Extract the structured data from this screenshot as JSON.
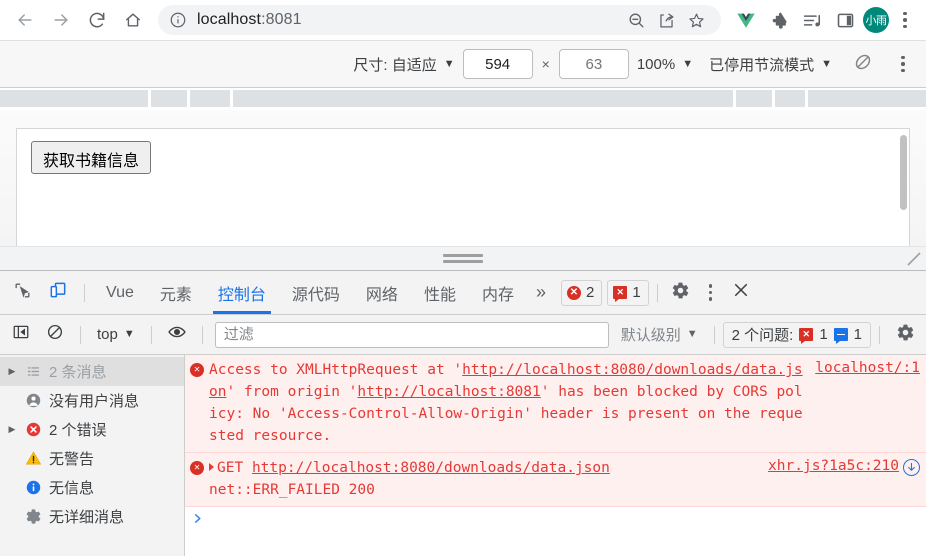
{
  "browser": {
    "url_main": "localhost",
    "url_port": ":8081",
    "profile_initials": "小雨",
    "icons": {
      "back": "back-arrow-icon",
      "forward": "forward-arrow-icon",
      "reload": "reload-icon",
      "home": "home-icon",
      "site_info": "info-circle-icon",
      "zoom_out": "zoom-out-icon",
      "share": "share-icon",
      "bookmark": "star-icon",
      "vue": "vue-devtools-icon",
      "extensions": "puzzle-piece-icon",
      "media": "media-playlist-icon",
      "side_panel": "side-panel-icon",
      "menu": "three-dot-menu-icon"
    }
  },
  "device_toolbar": {
    "size_label": "尺寸: 自适应",
    "width_value": "594",
    "height_placeholder": "63",
    "x_separator": "×",
    "zoom_label": "100%",
    "throttle_label": "已停用节流模式",
    "rotate_icon": "rotate-device-icon",
    "more_icon": "three-dot-menu-icon"
  },
  "page": {
    "fetch_button": "获取书籍信息"
  },
  "devtools": {
    "inspect_icon": "inspect-element-icon",
    "device_toggle_icon": "toggle-device-toolbar-icon",
    "tabs": [
      {
        "label": "Vue",
        "active": false
      },
      {
        "label": "元素",
        "active": false
      },
      {
        "label": "控制台",
        "active": true
      },
      {
        "label": "源代码",
        "active": false
      },
      {
        "label": "网络",
        "active": false
      },
      {
        "label": "性能",
        "active": false
      },
      {
        "label": "内存",
        "active": false
      }
    ],
    "more_tabs": "»",
    "error_badge_count": "2",
    "issue_badge_count": "1",
    "settings_icon": "gear-icon",
    "more_icon": "three-dot-menu-icon",
    "close_icon": "close-icon",
    "accent_color": "#1a73e8",
    "error_color": "#d93025"
  },
  "filterbar": {
    "sidebar_toggle_icon": "show-console-sidebar-icon",
    "clear_icon": "clear-console-icon",
    "context_label": "top",
    "eye_icon": "live-expression-icon",
    "filter_placeholder": "过滤",
    "filter_value": "",
    "level_label": "默认级别",
    "issues_label": "2 个问题:",
    "issues_error_count": "1",
    "issues_info_count": "1",
    "settings_icon": "gear-icon"
  },
  "console_sidebar": [
    {
      "label": "2 条消息",
      "icon": "list-icon",
      "arrow": true,
      "selected": true,
      "muted": true
    },
    {
      "label": "没有用户消息",
      "icon": "user-icon",
      "arrow": false,
      "selected": false,
      "muted": false
    },
    {
      "label": "2 个错误",
      "icon": "error-circle-icon",
      "arrow": true,
      "selected": false,
      "muted": false
    },
    {
      "label": "无警告",
      "icon": "warning-triangle-icon",
      "arrow": false,
      "selected": false,
      "muted": false
    },
    {
      "label": "无信息",
      "icon": "info-circle-icon",
      "arrow": false,
      "selected": false,
      "muted": false
    },
    {
      "label": "无详细消息",
      "icon": "verbose-gear-icon",
      "arrow": false,
      "selected": false,
      "muted": false
    }
  ],
  "console_messages": [
    {
      "type": "error",
      "icon": "error-circle-icon",
      "parts": [
        {
          "text": "Access to XMLHttpRequest at '",
          "link": false
        },
        {
          "text": "http://localhost:8080/downloads/data.json",
          "link": true
        },
        {
          "text": "' from origin '",
          "link": false
        },
        {
          "text": "http://localhost:8081",
          "link": true
        },
        {
          "text": "' has been blocked by CORS policy: No 'Access-Control-Allow-Origin' header is present on the requested resource.",
          "link": false
        }
      ],
      "source": "localhost/:1"
    },
    {
      "type": "error",
      "icon": "error-circle-icon",
      "expandable": true,
      "method": "GET",
      "url": "http://localhost:8080/downloads/data.json",
      "detail": "net::ERR_FAILED 200",
      "source": "xhr.js?1a5c:210",
      "network_icon": "open-in-network-panel-icon"
    }
  ],
  "console_prompt": {
    "caret": "❯"
  }
}
